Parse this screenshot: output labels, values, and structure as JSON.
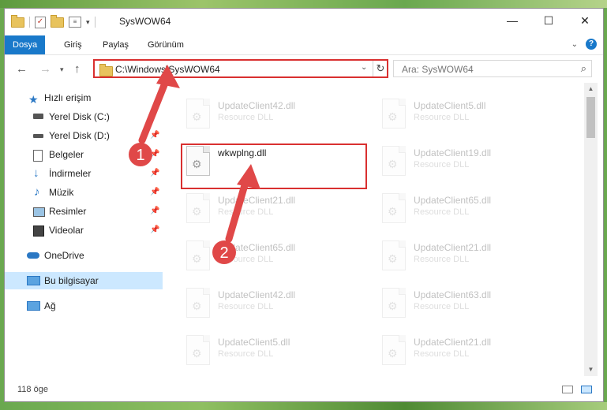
{
  "window": {
    "title": "SysWOW64",
    "minimize": "—",
    "maximize": "☐",
    "close": "✕"
  },
  "ribbon": {
    "tabs": [
      "Dosya",
      "Giriş",
      "Paylaş",
      "Görünüm"
    ]
  },
  "nav": {
    "address": "C:\\Windows\\SysWOW64",
    "search_placeholder": "Ara: SysWOW64"
  },
  "sidebar": {
    "items": [
      {
        "label": "Hızlı erişim",
        "icon": "star-icon"
      },
      {
        "label": "Yerel Disk (C:)",
        "icon": "drive-icon"
      },
      {
        "label": "Yerel Disk (D:)",
        "icon": "drive-icon"
      },
      {
        "label": "Belgeler",
        "icon": "documents-icon"
      },
      {
        "label": "İndirmeler",
        "icon": "download-icon"
      },
      {
        "label": "Müzik",
        "icon": "music-icon"
      },
      {
        "label": "Resimler",
        "icon": "pictures-icon"
      },
      {
        "label": "Videolar",
        "icon": "video-icon"
      },
      {
        "label": "OneDrive",
        "icon": "cloud-icon"
      },
      {
        "label": "Bu bilgisayar",
        "icon": "computer-icon"
      },
      {
        "label": "Ağ",
        "icon": "network-icon"
      }
    ]
  },
  "files": {
    "left": [
      {
        "name": "UpdateClient42.dll",
        "type": "Resource DLL"
      },
      {
        "name": "wkwplng.dll",
        "type": ""
      },
      {
        "name": "UpdateClient21.dll",
        "type": "Resource DLL"
      },
      {
        "name": "UpdateClient65.dll",
        "type": "Resource DLL"
      },
      {
        "name": "UpdateClient42.dll",
        "type": "Resource DLL"
      },
      {
        "name": "UpdateClient5.dll",
        "type": "Resource DLL"
      }
    ],
    "right": [
      {
        "name": "UpdateClient5.dll",
        "type": "Resource DLL"
      },
      {
        "name": "UpdateClient19.dll",
        "type": "Resource DLL"
      },
      {
        "name": "UpdateClient65.dll",
        "type": "Resource DLL"
      },
      {
        "name": "UpdateClient21.dll",
        "type": "Resource DLL"
      },
      {
        "name": "UpdateClient63.dll",
        "type": "Resource DLL"
      },
      {
        "name": "UpdateClient21.dll",
        "type": "Resource DLL"
      }
    ]
  },
  "status": {
    "count": "118 öge"
  },
  "annotations": {
    "step1": "1",
    "step2": "2",
    "color": "#e04848"
  }
}
